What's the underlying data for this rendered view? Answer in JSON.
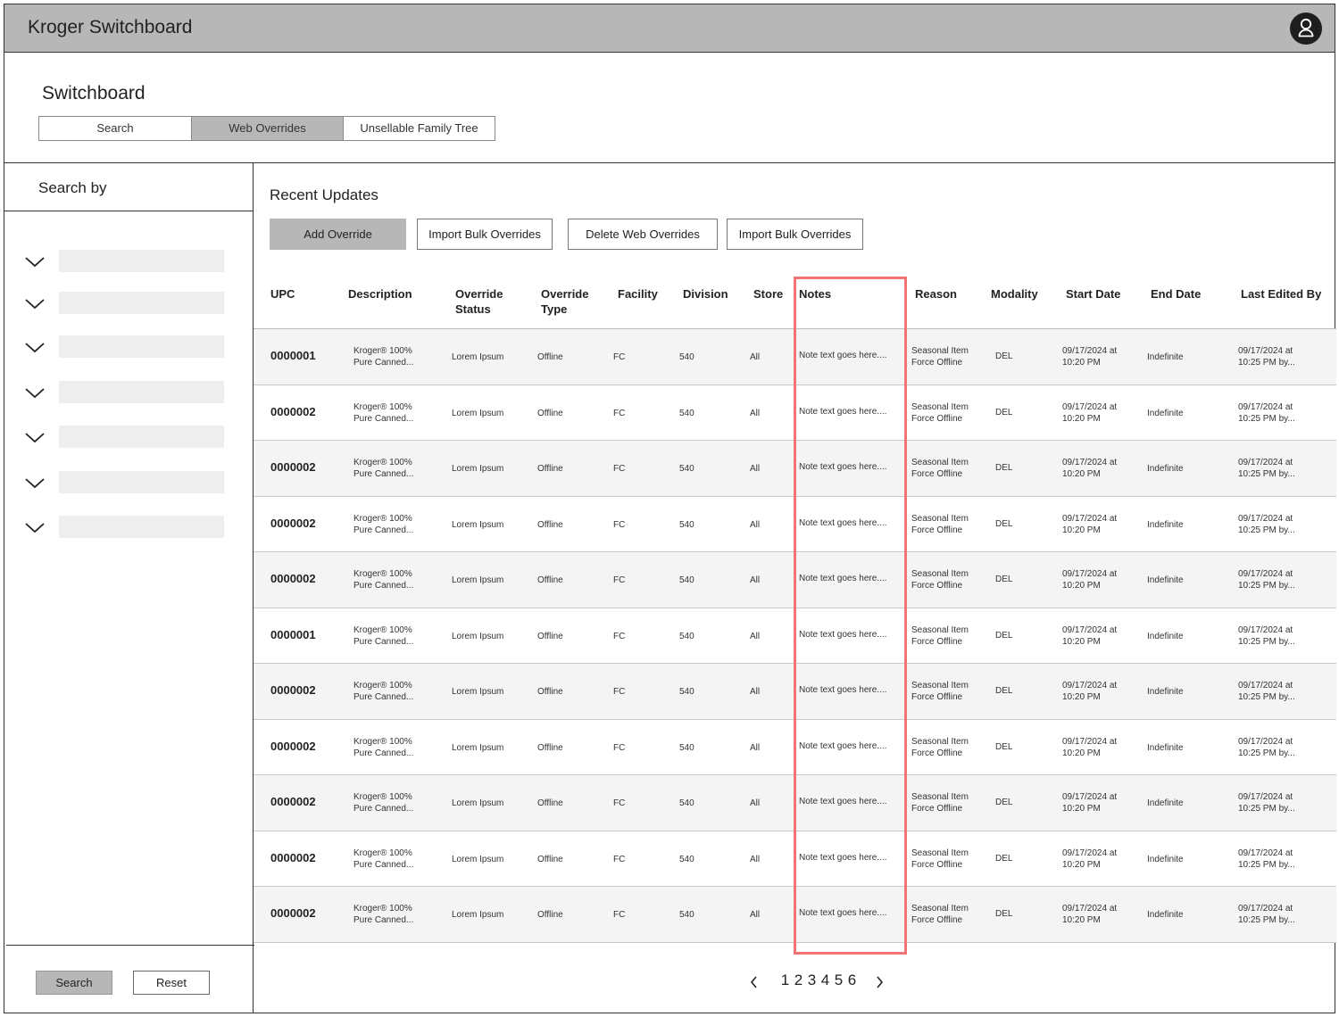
{
  "app": {
    "title": "Kroger Switchboard",
    "avatar_icon": "user-icon"
  },
  "page": {
    "title": "Switchboard"
  },
  "tabs": [
    {
      "label": "Search",
      "active": false
    },
    {
      "label": "Web Overrides",
      "active": true
    },
    {
      "label": "Unsellable Family Tree",
      "active": false
    }
  ],
  "sidebar": {
    "title": "Search by",
    "filter_count": 7,
    "search_label": "Search",
    "reset_label": "Reset"
  },
  "main": {
    "section_title": "Recent Updates",
    "actions": {
      "add": "Add Override",
      "import1": "Import Bulk Overrides",
      "delete": "Delete Web Overrides",
      "import2": "Import Bulk Overrides"
    }
  },
  "table": {
    "headers": {
      "upc": "UPC",
      "description": "Description",
      "override_status": "Override\nStatus",
      "override_type": "Override\nType",
      "facility": "Facility",
      "division": "Division",
      "store": "Store",
      "notes": "Notes",
      "reason": "Reason",
      "modality": "Modality",
      "start_date": "Start Date",
      "end_date": "End Date",
      "last_edited_by": "Last Edited By"
    },
    "rows": [
      {
        "upc": "0000001",
        "description": "Kroger® 100%\nPure Canned...",
        "override_status": "Lorem Ipsum",
        "override_type": "Offline",
        "facility": "FC",
        "division": "540",
        "store": "All",
        "notes": "Note text goes here....",
        "reason": "Seasonal Item\nForce Offline",
        "modality": "DEL",
        "start_date": "09/17/2024 at\n10:20 PM",
        "end_date": "Indefinite",
        "last_edited_by": "09/17/2024 at\n10:25 PM by..."
      },
      {
        "upc": "0000002",
        "description": "Kroger® 100%\nPure Canned...",
        "override_status": "Lorem Ipsum",
        "override_type": "Offline",
        "facility": "FC",
        "division": "540",
        "store": "All",
        "notes": "Note text goes here....",
        "reason": "Seasonal Item\nForce Offline",
        "modality": "DEL",
        "start_date": "09/17/2024 at\n10:20 PM",
        "end_date": "Indefinite",
        "last_edited_by": "09/17/2024 at\n10:25 PM by..."
      },
      {
        "upc": "0000002",
        "description": "Kroger® 100%\nPure Canned...",
        "override_status": "Lorem Ipsum",
        "override_type": "Offline",
        "facility": "FC",
        "division": "540",
        "store": "All",
        "notes": "Note text goes here....",
        "reason": "Seasonal Item\nForce Offline",
        "modality": "DEL",
        "start_date": "09/17/2024 at\n10:20 PM",
        "end_date": "Indefinite",
        "last_edited_by": "09/17/2024 at\n10:25 PM by..."
      },
      {
        "upc": "0000002",
        "description": "Kroger® 100%\nPure Canned...",
        "override_status": "Lorem Ipsum",
        "override_type": "Offline",
        "facility": "FC",
        "division": "540",
        "store": "All",
        "notes": "Note text goes here....",
        "reason": "Seasonal Item\nForce Offline",
        "modality": "DEL",
        "start_date": "09/17/2024 at\n10:20 PM",
        "end_date": "Indefinite",
        "last_edited_by": "09/17/2024 at\n10:25 PM by..."
      },
      {
        "upc": "0000002",
        "description": "Kroger® 100%\nPure Canned...",
        "override_status": "Lorem Ipsum",
        "override_type": "Offline",
        "facility": "FC",
        "division": "540",
        "store": "All",
        "notes": "Note text goes here....",
        "reason": "Seasonal Item\nForce Offline",
        "modality": "DEL",
        "start_date": "09/17/2024 at\n10:20 PM",
        "end_date": "Indefinite",
        "last_edited_by": "09/17/2024 at\n10:25 PM by..."
      },
      {
        "upc": "0000001",
        "description": "Kroger® 100%\nPure Canned...",
        "override_status": "Lorem Ipsum",
        "override_type": "Offline",
        "facility": "FC",
        "division": "540",
        "store": "All",
        "notes": "Note text goes here....",
        "reason": "Seasonal Item\nForce Offline",
        "modality": "DEL",
        "start_date": "09/17/2024 at\n10:20 PM",
        "end_date": "Indefinite",
        "last_edited_by": "09/17/2024 at\n10:25 PM by..."
      },
      {
        "upc": "0000002",
        "description": "Kroger® 100%\nPure Canned...",
        "override_status": "Lorem Ipsum",
        "override_type": "Offline",
        "facility": "FC",
        "division": "540",
        "store": "All",
        "notes": "Note text goes here....",
        "reason": "Seasonal Item\nForce Offline",
        "modality": "DEL",
        "start_date": "09/17/2024 at\n10:20 PM",
        "end_date": "Indefinite",
        "last_edited_by": "09/17/2024 at\n10:25 PM by..."
      },
      {
        "upc": "0000002",
        "description": "Kroger® 100%\nPure Canned...",
        "override_status": "Lorem Ipsum",
        "override_type": "Offline",
        "facility": "FC",
        "division": "540",
        "store": "All",
        "notes": "Note text goes here....",
        "reason": "Seasonal Item\nForce Offline",
        "modality": "DEL",
        "start_date": "09/17/2024 at\n10:20 PM",
        "end_date": "Indefinite",
        "last_edited_by": "09/17/2024 at\n10:25 PM by..."
      },
      {
        "upc": "0000002",
        "description": "Kroger® 100%\nPure Canned...",
        "override_status": "Lorem Ipsum",
        "override_type": "Offline",
        "facility": "FC",
        "division": "540",
        "store": "All",
        "notes": "Note text goes here....",
        "reason": "Seasonal Item\nForce Offline",
        "modality": "DEL",
        "start_date": "09/17/2024 at\n10:20 PM",
        "end_date": "Indefinite",
        "last_edited_by": "09/17/2024 at\n10:25 PM by..."
      },
      {
        "upc": "0000002",
        "description": "Kroger® 100%\nPure Canned...",
        "override_status": "Lorem Ipsum",
        "override_type": "Offline",
        "facility": "FC",
        "division": "540",
        "store": "All",
        "notes": "Note text goes here....",
        "reason": "Seasonal Item\nForce Offline",
        "modality": "DEL",
        "start_date": "09/17/2024 at\n10:20 PM",
        "end_date": "Indefinite",
        "last_edited_by": "09/17/2024 at\n10:25 PM by..."
      },
      {
        "upc": "0000002",
        "description": "Kroger® 100%\nPure Canned...",
        "override_status": "Lorem Ipsum",
        "override_type": "Offline",
        "facility": "FC",
        "division": "540",
        "store": "All",
        "notes": "Note text goes here....",
        "reason": "Seasonal Item\nForce Offline",
        "modality": "DEL",
        "start_date": "09/17/2024 at\n10:20 PM",
        "end_date": "Indefinite",
        "last_edited_by": "09/17/2024 at\n10:25 PM by..."
      }
    ]
  },
  "pagination": {
    "prev_icon": "chevron-left-icon",
    "next_icon": "chevron-right-icon",
    "pages": [
      "1",
      "2",
      "3",
      "4",
      "5",
      "6"
    ]
  },
  "colors": {
    "header_bg": "#b7b7b7",
    "row_alt_bg": "#f4f4f4",
    "notes_highlight": "#f27474",
    "avatar_bg": "#1e1e1e"
  }
}
